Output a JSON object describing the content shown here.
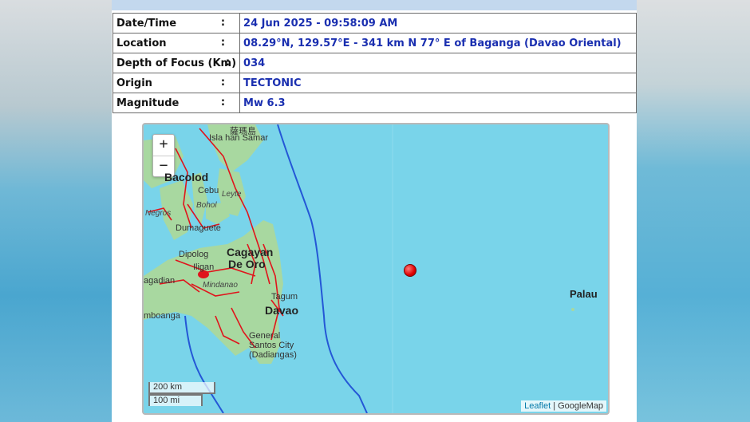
{
  "details": {
    "rows": [
      {
        "label": "Date/Time",
        "value": "24 Jun 2025 - 09:58:09 AM"
      },
      {
        "label": "Location",
        "value": "08.29°N, 129.57°E - 341 km N 77° E of Baganga (Davao Oriental)"
      },
      {
        "label": "Depth of Focus (Km)",
        "value": "034"
      },
      {
        "label": "Origin",
        "value": "TECTONIC"
      },
      {
        "label": "Magnitude",
        "value": "Mw 6.3"
      }
    ],
    "separator": ":"
  },
  "map": {
    "zoom_in": "+",
    "zoom_out": "−",
    "labels": {
      "samar_native": "薩瑪島",
      "samar": "Isla han Samar",
      "leyte": "Leyte",
      "bacolod": "Bacolod",
      "cebu": "Cebu",
      "bohol": "Bohol",
      "negros": "Negros",
      "dumaguete": "Dumaguete",
      "dipolog": "Dipolog",
      "iligan": "Iligan",
      "cagayan_de_oro_1": "Cagayan",
      "cagayan_de_oro_2": "De Oro",
      "gadian": "agadian",
      "mindanao": "Mindanao",
      "tagum": "Tagum",
      "davao": "Davao",
      "zamboanga": "mboanga",
      "gensan_1": "General",
      "gensan_2": "Santos City",
      "gensan_3": "(Dadiangas)",
      "palau": "Palau"
    },
    "scale_km": "200 km",
    "scale_mi": "100 mi",
    "attribution_leaflet": "Leaflet",
    "attribution_sep": "|",
    "attribution_google": "GoogleMap",
    "colors": {
      "sea": "#79d4ea",
      "land": "#a8d8a0",
      "fault": "#e0141c",
      "trench": "#2457d6",
      "marker": "#e00000"
    }
  }
}
